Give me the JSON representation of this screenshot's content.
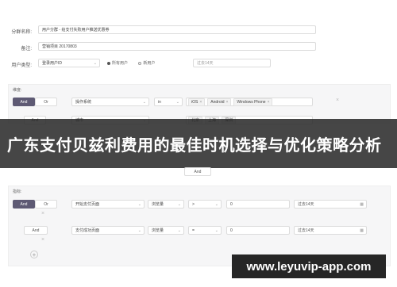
{
  "form": {
    "group_name_label": "分群名称:",
    "group_name_value": "用户分群 - 给支付失败用户推送优惠券",
    "remark_label": "备注:",
    "remark_value": "营销项目 20170803",
    "user_type_label": "用户类型:",
    "user_type_value": "登录用户ID",
    "radio_all": "所有用户",
    "radio_new": "新用户",
    "date_value": "过去14天"
  },
  "dimension": {
    "title": "维度:",
    "and_label": "And",
    "or_label": "Or",
    "field": "操作系统",
    "op": "in",
    "tags": [
      "iOS",
      "Android",
      "Windows Phone"
    ],
    "row2_field": "城市",
    "row2_tags": [
      "北京",
      "上海",
      "深圳"
    ]
  },
  "and_divider": "And",
  "metric": {
    "title": "指标:",
    "and_label": "And",
    "or_label": "Or",
    "rows": [
      {
        "event": "开始支付页面",
        "measure": "浏览量",
        "op": ">",
        "value": "0",
        "date": "过去14天"
      },
      {
        "event": "支付成功页面",
        "measure": "浏览量",
        "op": "=",
        "value": "0",
        "date": "过去14天"
      }
    ],
    "and2": "And"
  },
  "banner_text": "广东支付贝兹利费用的最佳时机选择与优化策略分析",
  "footer_text": "www.leyuvip-app.com"
}
